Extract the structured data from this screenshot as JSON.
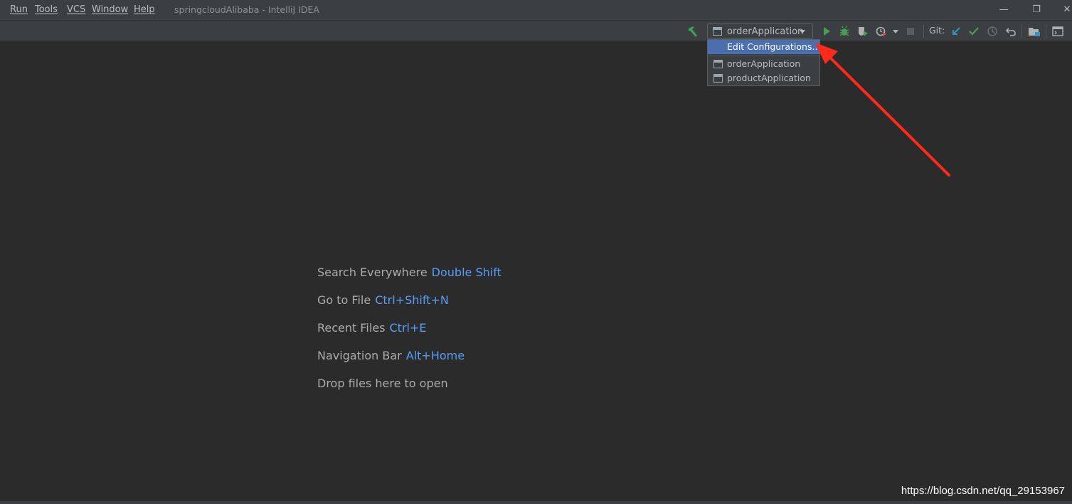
{
  "menu": {
    "items": [
      "Run",
      "Tools",
      "VCS",
      "Window",
      "Help"
    ]
  },
  "window": {
    "title": "springcloudAlibaba - IntelliJ IDEA",
    "minimize_glyph": "—",
    "restore_glyph": "❐",
    "close_glyph": "✕"
  },
  "toolbar": {
    "run_config": "orderApplication",
    "git_label": "Git:",
    "icons": [
      "build-hammer-icon",
      "run-icon",
      "debug-icon",
      "coverage-icon",
      "profile-icon",
      "stop-icon",
      "vcs-update-icon",
      "vcs-commit-icon",
      "vcs-history-icon",
      "vcs-revert-icon",
      "project-structure-icon",
      "terminal-icon"
    ]
  },
  "dropdown": {
    "items": [
      {
        "label": "Edit Configurations...",
        "selected": true
      },
      {
        "label": "orderApplication",
        "selected": false
      },
      {
        "label": "productApplication",
        "selected": false
      }
    ]
  },
  "hints": [
    {
      "label": "Search Everywhere",
      "key": "Double Shift"
    },
    {
      "label": "Go to File",
      "key": "Ctrl+Shift+N"
    },
    {
      "label": "Recent Files",
      "key": "Ctrl+E"
    },
    {
      "label": "Navigation Bar",
      "key": "Alt+Home"
    },
    {
      "label": "Drop files here to open",
      "key": ""
    }
  ],
  "watermark": "https://blog.csdn.net/qq_29153967",
  "colors": {
    "background": "#2b2b2b",
    "panel": "#3c3f41",
    "accent_key": "#589df6",
    "selection": "#4b6eaf",
    "annotation_arrow": "#ff2a1a"
  }
}
